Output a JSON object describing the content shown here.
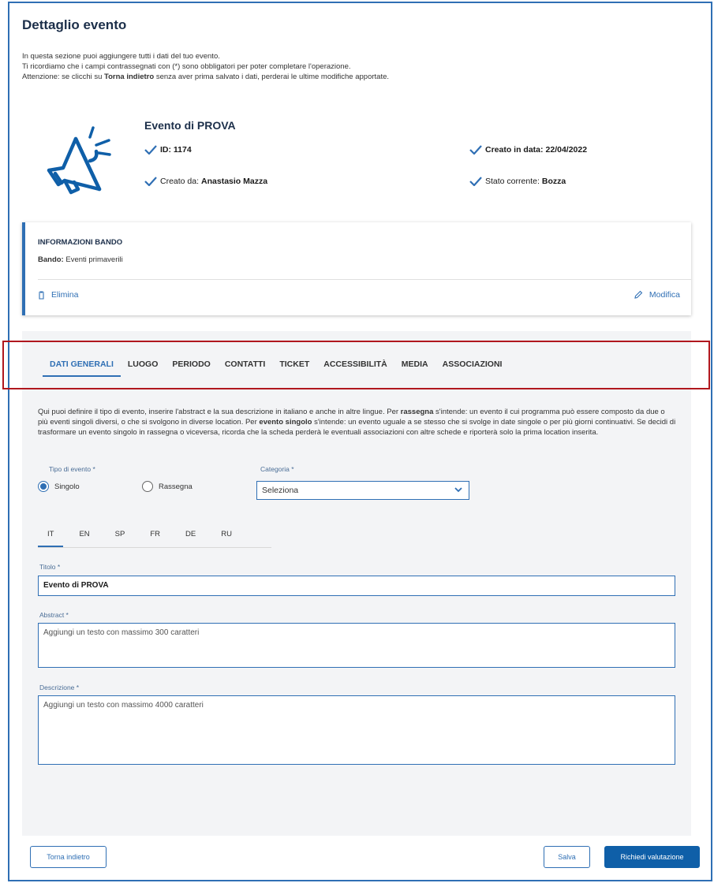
{
  "header": {
    "title": "Dettaglio evento",
    "intro_line1": "In questa sezione puoi aggiungere tutti i dati del tuo evento.",
    "intro_line2": "Ti ricordiamo che i campi contrassegnati con (*) sono obbligatori per poter completare l'operazione.",
    "intro_line3_pre": "Attenzione: se clicchi su ",
    "intro_line3_bold": "Torna indietro",
    "intro_line3_post": " senza aver prima salvato i dati, perderai le ultime modifiche apportate."
  },
  "event": {
    "icon": "megaphone-icon",
    "name": "Evento di PROVA",
    "id_label": "ID: 1174",
    "created_date_label": "Creato in data:",
    "created_date_value": "22/04/2022",
    "created_by_label": "Creato da:",
    "created_by_value": "Anastasio Mazza",
    "status_label": "Stato corrente:",
    "status_value": "Bozza"
  },
  "bando_card": {
    "title": "INFORMAZIONI BANDO",
    "bando_label": "Bando:",
    "bando_value": "Eventi primaverili",
    "delete_label": "Elimina",
    "edit_label": "Modifica"
  },
  "tabs": [
    {
      "label": "DATI GENERALI",
      "active": true
    },
    {
      "label": "LUOGO",
      "active": false
    },
    {
      "label": "PERIODO",
      "active": false
    },
    {
      "label": "CONTATTI",
      "active": false
    },
    {
      "label": "TICKET",
      "active": false
    },
    {
      "label": "ACCESSIBILITÀ",
      "active": false
    },
    {
      "label": "MEDIA",
      "active": false
    },
    {
      "label": "ASSOCIAZIONI",
      "active": false
    }
  ],
  "description": {
    "p1": "Qui puoi definire il tipo di evento, inserire l'abstract e la sua descrizione in italiano e anche in altre lingue. Per ",
    "b1": "rassegna",
    "p2": " s'intende: un evento il cui programma può essere composto da due o più eventi singoli diversi, o che si svolgono in diverse location. Per ",
    "b2": "evento singolo",
    "p3": " s'intende: un evento uguale a se stesso che si svolge in date singole o per più giorni continuativi. Se decidi di trasformare un evento singolo in rassegna o viceversa, ricorda che la scheda perderà le eventuali associazioni con altre schede e riporterà solo la prima location inserita."
  },
  "form": {
    "event_type_label": "Tipo di evento *",
    "radio_single": "Singolo",
    "radio_rassegna": "Rassegna",
    "category_label": "Categoria *",
    "category_value": "Seleziona",
    "languages": [
      "IT",
      "EN",
      "SP",
      "FR",
      "DE",
      "RU"
    ],
    "title_label": "Titolo *",
    "title_value": "Evento di PROVA",
    "abstract_label": "Abstract *",
    "abstract_placeholder": "Aggiungi un testo con massimo 300 caratteri",
    "description_label": "Descrizione *",
    "description_placeholder": "Aggiungi un testo con massimo 4000 caratteri"
  },
  "footer": {
    "back_label": "Torna indietro",
    "save_label": "Salva",
    "request_label": "Richiedi valutazione"
  },
  "colors": {
    "accent": "#2f6fb4",
    "primary_button": "#0f5fa8",
    "highlight_box": "#b0171e",
    "heading": "#1c2f4a"
  }
}
